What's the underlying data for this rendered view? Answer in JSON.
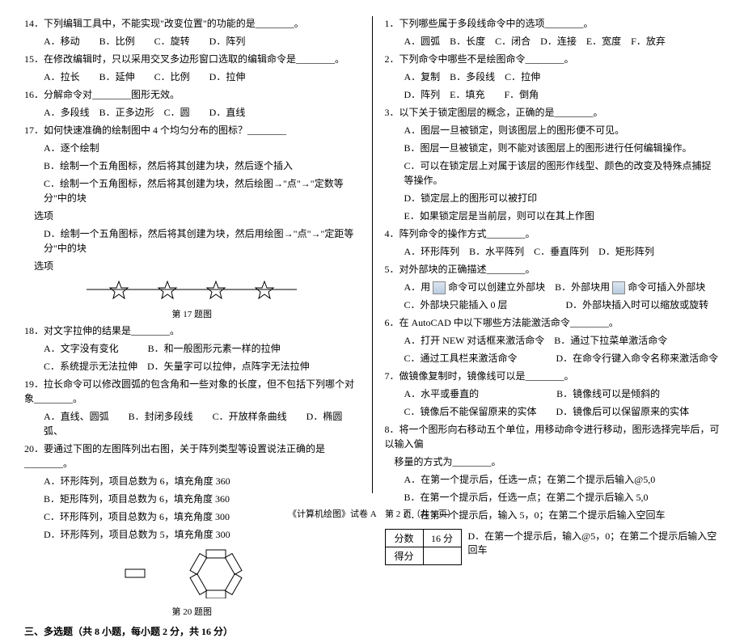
{
  "left": {
    "q14": {
      "stem": "14．下列编辑工具中，不能实现\"改变位置\"的功能的是________。",
      "opts": "A．移动　　B．比例　　C．旋转　　D．阵列"
    },
    "q15": {
      "stem": "15．在修改编辑时，只以采用交叉多边形窗口选取的编辑命令是________。",
      "opts": "A．拉长　　B．延伸　　C．比例　　D．拉伸"
    },
    "q16": {
      "stem": "16．分解命令对________图形无效。",
      "opts": "A．多段线　B．正多边形　C．圆　　D．直线"
    },
    "q17": {
      "stem": "17．如何快速准确的绘制图中 4 个均匀分布的图标？________",
      "a": "A．逐个绘制",
      "b": "B．绘制一个五角图标，然后将其创建为块，然后逐个插入",
      "c": "C．绘制一个五角图标，然后将其创建为块，然后绘图→\"点\"→\"定数等分\"中的块",
      "c2": "选项",
      "d": "D．绘制一个五角图标，然后将其创建为块，然后用绘图→\"点\"→\"定距等分\"中的块",
      "d2": "选项",
      "figcap": "第 17 题图"
    },
    "q18": {
      "stem": "18．对文字拉伸的结果是________。",
      "ab": "A．文字没有变化　　　B．和一般图形元素一样的拉伸",
      "cd": "C．系统提示无法拉伸　D．矢量字可以拉伸，点阵字无法拉伸"
    },
    "q19": {
      "stem": "19．拉长命令可以修改圆弧的包含角和一些对象的长度，但不包括下列哪个对象________。",
      "opts": "A．直线、圆弧　　B．封闭多段线　　C．开放样条曲线　　D．椭圆弧、"
    },
    "q20": {
      "stem": "20．要通过下图的左图阵列出右图，关于阵列类型等设置说法正确的是________。",
      "a": "A．环形阵列，项目总数为 6，填充角度 360",
      "b": "B．矩形阵列，项目总数为 6，填充角度 360",
      "c": "C．环形阵列，项目总数为 6，填充角度 300",
      "d": "D．环形阵列，项目总数为 5，填充角度 300",
      "figcap": "第 20 题图"
    },
    "section3": "三、多选题（共 8 小题，每小题 2 分，共 16 分）"
  },
  "right": {
    "q1": {
      "stem": "1．下列哪些属于多段线命令中的选项________。",
      "opts": "A．圆弧　B．长度　C．闭合　D．连接　E．宽度　F．放弃"
    },
    "q2": {
      "stem": "2．下列命令中哪些不是绘图命令________。",
      "ab": "A．复制　B．多段线　C．拉伸",
      "cde": "D．阵列　E．填充　　F．倒角"
    },
    "q3": {
      "stem": "3．以下关于锁定图层的概念，正确的是________。",
      "a": "A．图层一旦被锁定，则该图层上的图形便不可见。",
      "b": "B．图层一旦被锁定，则不能对该图层上的图形进行任何编辑操作。",
      "c": "C．可以在锁定层上对属于该层的图形作线型、颜色的改变及特殊点捕捉等操作。",
      "d": "D．锁定层上的图形可以被打印",
      "e": "E．如果锁定层是当前层，则可以在其上作图"
    },
    "q4": {
      "stem": "4．阵列命令的操作方式________。",
      "opts": "A．环形阵列　B．水平阵列　C．垂直阵列　D．矩形阵列"
    },
    "q5": {
      "stem": "5．对外部块的正确描述________。",
      "a_pre": "A．用",
      "a_post": "命令可以创建立外部块　B．外部块用",
      "a_end": "命令可插入外部块",
      "cd": "C．外部块只能插入 0 层　　　　　　D．外部块插入时可以缩放或旋转"
    },
    "q6": {
      "stem": "6．在 AutoCAD 中以下哪些方法能激活命令________。",
      "ab": "A．打开 NEW 对话框来激活命令　B．通过下拉菜单激活命令",
      "cd": "C．通过工具栏来激活命令　　　　D．在命令行键入命令名称来激活命令"
    },
    "q7": {
      "stem": "7．做镜像复制时，镜像线可以是________。",
      "ab": "A．水平或垂直的　　　　　　　　B．镜像线可以是倾斜的",
      "cd": "C．镜像后不能保留原来的实体　　D．镜像后可以保留原来的实体"
    },
    "q8": {
      "stem": "8．将一个图形向右移动五个单位，用移动命令进行移动，图形选择完毕后，可以输入偏",
      "stem2": "移量的方式为________。",
      "a": "A．在第一个提示后，任选一点；在第二个提示后输入@5,0",
      "b": "B．在第一个提示后，任选一点；在第二个提示后输入 5,0",
      "c": "C．在第一个提示后，输入 5，0；在第二个提示后输入空回车",
      "d": "D．在第一个提示后，输入@5，0；在第二个提示后输入空回车"
    },
    "score": {
      "h1": "分数",
      "h2": "16 分",
      "r2": "得分"
    }
  },
  "footer": "《计算机绘图》试卷 A　第 2 页（共 3 页）"
}
